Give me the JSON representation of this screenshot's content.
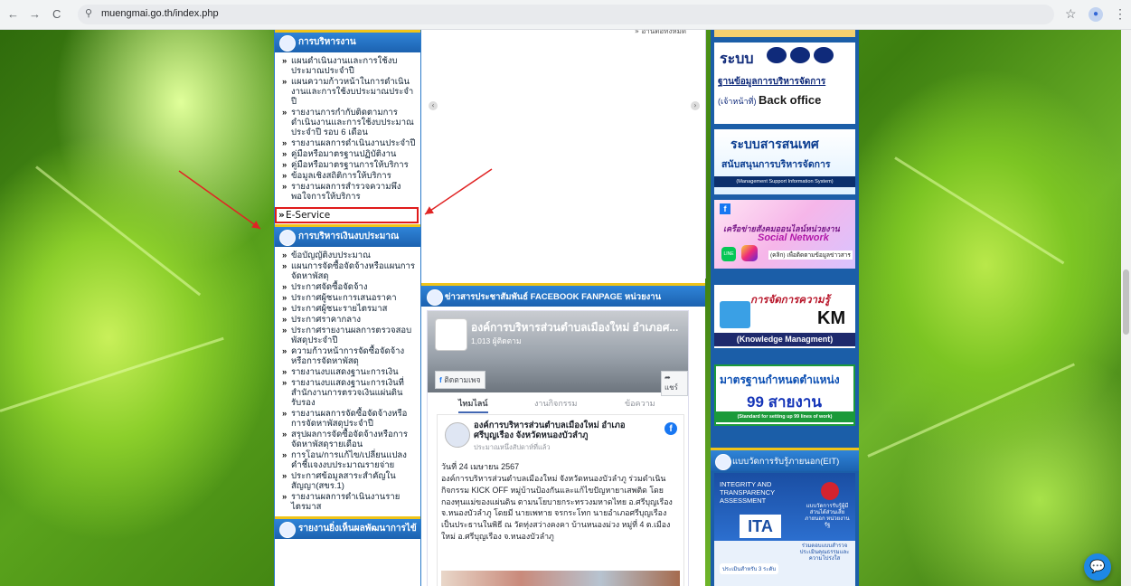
{
  "browser": {
    "url": "muengmai.go.th/index.php",
    "nav_icons": {
      "back": "←",
      "forward": "→",
      "reload": "C",
      "site_info": "⚲",
      "bookmark": "☆",
      "menu": "⋮"
    }
  },
  "left": {
    "section1_title": "การบริหารงาน",
    "section1_items": [
      "แผนดำเนินงานและการใช้งบประมาณประจำปี",
      "แผนความก้าวหน้าในการดำเนินงานและการใช้งบประมาณประจำปี",
      "รายงานการกำกับติดตามการดำเนินงานและการใช้งบประมาณประจำปี รอบ 6 เดือน",
      "รายงานผลการดำเนินงานประจำปี",
      "คู่มือหรือมาตรฐานปฏิบัติงาน",
      "คู่มือหรือมาตรฐานการให้บริการ",
      "ข้อมูลเชิงสถิติการให้บริการ",
      "รายงานผลการสำรวจความพึงพอใจการให้บริการ"
    ],
    "eservice_label": "E-Service",
    "section2_title": "การบริหารเงินงบประมาณ",
    "section2_items": [
      "ข้อบัญญัติงบประมาณ",
      "แผนการจัดซื้อจัดจ้างหรือแผนการจัดหาพัสดุ",
      "ประกาศจัดซื้อจัดจ้าง",
      "ประกาศผู้ชนะการเสนอราคา",
      "ประกาศผู้ชนะรายไตรมาส",
      "ประกาศราคากลาง",
      "ประกาศรายงานผลการตรวจสอบพัสดุประจำปี",
      "ความก้าวหน้าการจัดซื้อจัดจ้างหรือการจัดหาพัสดุ",
      "รายงานงบแสดงฐานะการเงิน",
      "รายงานงบแสดงฐานะการเงินที่สำนักงานการตรวจเงินแผ่นดินรับรอง",
      "รายงานผลการจัดซื้อจัดจ้างหรือการจัดหาพัสดุประจำปี",
      "สรุปผลการจัดซื้อจัดจ้างหรือการจัดหาพัสดุรายเดือน",
      "การโอน/การแก้ไข/เปลี่ยนแปลงคำชี้แจงงบประมาณรายจ่าย",
      "ประกาศข้อมูลสาระสำคัญในสัญญา(สขร.1)",
      "รายงานผลการดำเนินงานรายไตรมาส"
    ],
    "section3_title": "รายงานยิ่งเห็นผลพัฒนาการไข้"
  },
  "middle": {
    "top_link": "» อ่านต่อทั้งหมด",
    "arrow_left": "‹",
    "arrow_right": "›",
    "fb_section_title": "ข่าวสารประชาสัมพันธ์ FACEBOOK FANPAGE หน่วยงาน",
    "fb_page_name": "องค์การบริหารส่วนตำบลเมืองใหม่ อำเภอศ...",
    "fb_likes": "1,013 ผู้ติดตาม",
    "fb_follow": "ติดตามเพจ",
    "fb_share": "แชร์",
    "fb_tabs": [
      "ไทมไลน์",
      "งานกิจกรรม",
      "ข้อความ"
    ],
    "post_author": "องค์การบริหารส่วนตำบลเมืองใหม่ อำเภอศรีบุญเรือง จังหวัดหนองบัวลำภู",
    "post_time": "ประมาณหนึ่งสัปดาห์ที่แล้ว",
    "post_date": "วันที่ 24 เมษายน 2567",
    "post_body": "องค์การบริหารส่วนตำบลเมืองใหม่ จังหวัดหนองบัวลำภู ร่วมดำเนินกิจกรรม KICK OFF หมู่บ้านป้องกันและแก้ไขปัญหายาเสพติด โดยกองทุนแม่ของแผ่นดิน ตามนโยบายกระทรวงมหาดไทย อ.ศรีบุญเรือง จ.หนองบัวลำภู โดยมี นายเพทาย จรกระโทก นายอำเภอศรีบุญเรือง เป็นประธานในพิธี ณ วัดทุ่งสว่างคงคา บ้านหนองม่วง หมู่ที่ 4 ต.เมืองใหม่ อ.ศรีบุญเรือง จ.หนองบัวลำภู"
  },
  "right": {
    "smp_title": "ระบบ",
    "smp_line2": "ฐานข้อมูลการบริหารจัดการ",
    "smp_small": "(เจ้าหน้าที่)",
    "smp_back": "Back office",
    "info_title": "ระบบสารสนเทศ",
    "info_sub": "สนับสนุนการบริหารจัดการ",
    "info_en": "(Management Support Information System)",
    "social_t1": "เครือข่ายสังคมออนไลน์หน่วยงาน",
    "social_t2": "Social Network",
    "social_t3": "(คลิก) เพื่อติดตามข้อมูลข่าวสาร",
    "km_t1": "การจัดการความรู้",
    "km_t2": "KM",
    "km_t3": "(Knowledge Managment)",
    "std_t1": "มาตรฐานกำหนดตำแหน่ง",
    "std_t2": "99 สายงาน",
    "std_t3": "(Standard for setting up 99 lines of work)",
    "eit_title": "แบบวัดการรับรู้ภายนอก(EIT)",
    "ita_t1": "INTEGRITY AND TRANSPARENCY ASSESSMENT",
    "ita_logo": "ITA",
    "ita_t2": "แบบวัดการรับรู้ผู้มีส่วนได้ส่วนเสียภายนอก หน่วยงานรัฐ",
    "ita_t3": "ร่วมตอบแบบสำรวจ ประเมินคุณธรรมและความโปร่งใส",
    "ita_t4": "ประเมินสำหรับ 3 ระดับ"
  },
  "chat_icon": "💬",
  "colors": {
    "accent_blue": "#1c62b0",
    "highlight_red": "#e01b1b",
    "arrow_red": "#e02424",
    "gold": "#f0c419"
  }
}
